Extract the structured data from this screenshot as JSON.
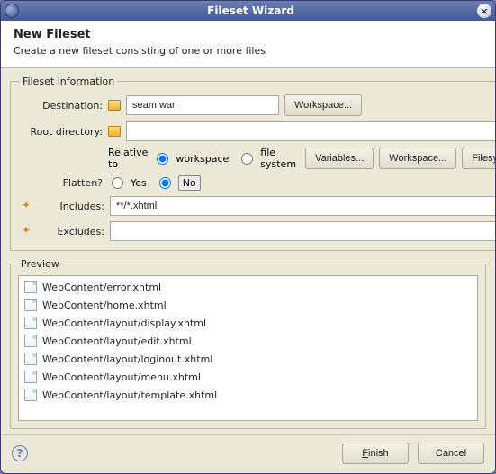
{
  "titlebar": {
    "title": "Fileset Wizard"
  },
  "header": {
    "title": "New Fileset",
    "subtitle": "Create a new fileset consisting of one or more files"
  },
  "info": {
    "legend": "Fileset information",
    "destination_label": "Destination:",
    "destination_value": "seam.war",
    "workspace_btn": "Workspace...",
    "rootdir_label": "Root directory:",
    "rootdir_value": "",
    "relative_label": "Relative to",
    "rel_workspace": "workspace",
    "rel_filesystem": "file system",
    "variables_btn": "Variables...",
    "workspace2_btn": "Workspace...",
    "filesystem_btn": "Filesystem...",
    "flatten_label": "Flatten?",
    "flatten_yes": "Yes",
    "flatten_no": "No",
    "includes_label": "Includes:",
    "includes_value": "**/*.xhtml",
    "excludes_label": "Excludes:",
    "excludes_value": ""
  },
  "preview": {
    "legend": "Preview",
    "items": [
      "WebContent/error.xhtml",
      "WebContent/home.xhtml",
      "WebContent/layout/display.xhtml",
      "WebContent/layout/edit.xhtml",
      "WebContent/layout/loginout.xhtml",
      "WebContent/layout/menu.xhtml",
      "WebContent/layout/template.xhtml"
    ]
  },
  "footer": {
    "finish": "Finish",
    "cancel": "Cancel"
  }
}
